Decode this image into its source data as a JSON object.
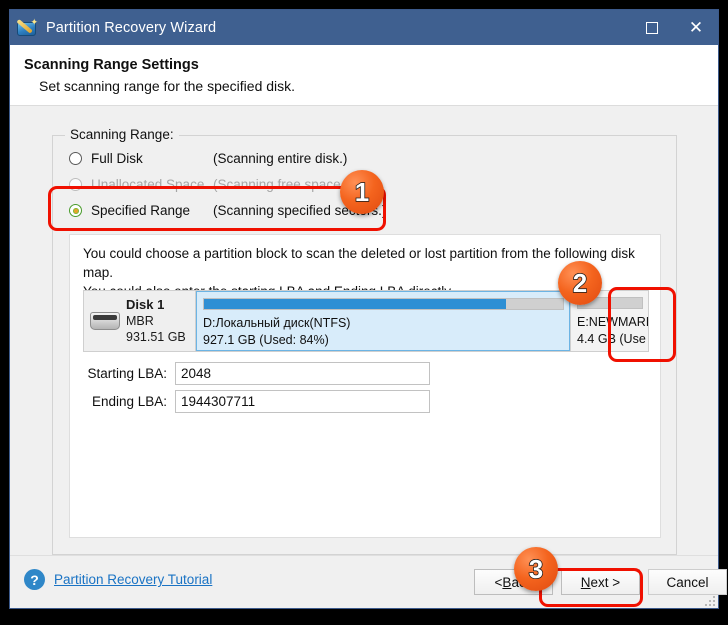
{
  "window": {
    "title": "Partition Recovery Wizard",
    "app_icon": "partition-wizard-icon",
    "maximize_label": "Maximize",
    "close_label": "Close"
  },
  "header": {
    "title": "Scanning Range Settings",
    "subtitle": "Set scanning range for the specified disk."
  },
  "group": {
    "legend": "Scanning Range:",
    "options": [
      {
        "label": "Full Disk",
        "note": "(Scanning entire disk.)",
        "checked": false,
        "disabled": false
      },
      {
        "label": "Unallocated Space",
        "note": "(Scanning free space only.)",
        "checked": false,
        "disabled": true
      },
      {
        "label": "Specified Range",
        "note": "(Scanning specified sectors.)",
        "checked": true,
        "disabled": false
      }
    ]
  },
  "panel": {
    "instructions_line1": "You could choose a partition block to scan the deleted or lost partition from the following disk map.",
    "instructions_line2": "You could also enter the starting LBA and Ending LBA directly."
  },
  "disk": {
    "icon": "hard-disk-icon",
    "name": "Disk 1",
    "scheme": "MBR",
    "capacity": "931.51 GB",
    "partitions": [
      {
        "label": "D:Локальный диск(NTFS)",
        "size_line": "927.1 GB (Used: 84%)",
        "used_percent": 84,
        "selected": true,
        "fill_color": "#2e8fd4",
        "background": "#d8ecfa"
      },
      {
        "label": "E:NEWMARI",
        "size_line": "4.4 GB (Use",
        "used_percent": 100,
        "selected": false,
        "fill_color": "#d0d0d0",
        "background": "#f3f3f3"
      }
    ]
  },
  "fields": {
    "starting_lba_label": "Starting LBA:",
    "starting_lba_value": "2048",
    "ending_lba_label": "Ending LBA:",
    "ending_lba_value": "1944307711"
  },
  "footer": {
    "help_icon": "question-mark-icon",
    "tutorial_link": "Partition Recovery Tutorial",
    "back_pre": "< ",
    "back_mnemonic": "B",
    "back_post": "ack",
    "next_mnemonic": "N",
    "next_post": "ext >",
    "cancel_label": "Cancel"
  },
  "annotations": {
    "badge1": "1",
    "badge2": "2",
    "badge3": "3",
    "highlight_color": "#f01000",
    "badge_color": "#f4641e"
  }
}
